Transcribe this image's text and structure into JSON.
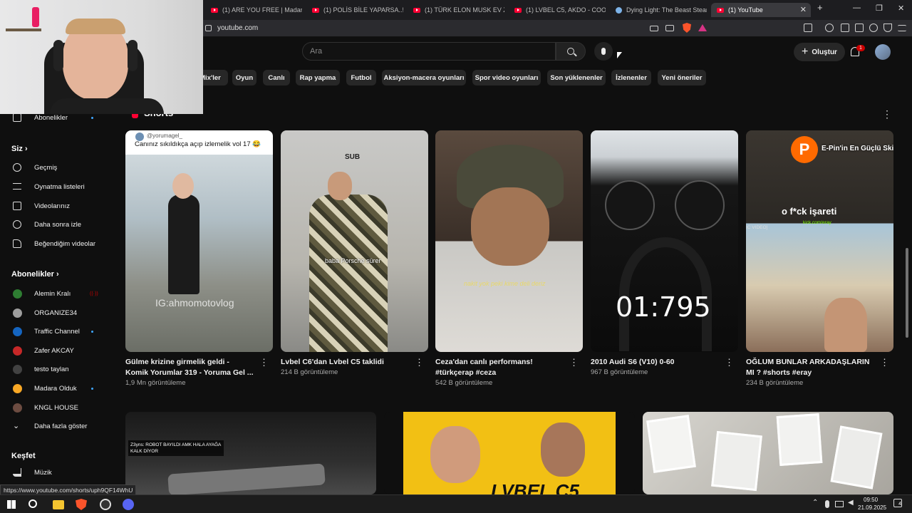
{
  "browser": {
    "tabs": [
      {
        "label": "(1) ARE YOU FREE | Madara Ol"
      },
      {
        "label": "(1) POLİS BİLE YAPARSA..! Türki"
      },
      {
        "label": "(1) TÜRK ELON MUSK EV ZİYAR"
      },
      {
        "label": "(1) LVBEL C5, AKDO - COOOK İ"
      },
      {
        "label": "Dying Light: The Beast Steam'd"
      },
      {
        "label": "(1) YouTube"
      }
    ],
    "url": "youtube.com",
    "window_controls": {
      "minimize": "—",
      "restore": "❐",
      "close": "✕"
    },
    "new_tab": "+"
  },
  "youtube": {
    "search_placeholder": "Ara",
    "create_label": "Oluştur",
    "notification_count": "1",
    "chips": [
      "Mix'ler",
      "Oyun",
      "Canlı",
      "Rap yapma",
      "Futbol",
      "Aksiyon-macera oyunları",
      "Spor video oyunları",
      "Son yüklenenler",
      "İzlenenler",
      "Yeni öneriler"
    ],
    "sidebar": {
      "top_item": "Abonelikler",
      "you_header": "Siz",
      "you_items": [
        "Geçmiş",
        "Oynatma listeleri",
        "Videolarınız",
        "Daha sonra izle",
        "Beğendiğim videolar"
      ],
      "subs_header": "Abonelikler",
      "subs": [
        {
          "name": "Alemin Kralı",
          "live": "((·))",
          "color": "#2e7d32"
        },
        {
          "name": "ORGANIZE34",
          "color": "#9e9e9e"
        },
        {
          "name": "Traffic Channel",
          "color": "#1565c0"
        },
        {
          "name": "Zafer AKCAY",
          "color": "#c62828"
        },
        {
          "name": "testo taylan",
          "color": "#424242"
        },
        {
          "name": "Madara Olduk",
          "color": "#f9a825"
        },
        {
          "name": "KNGL HOUSE",
          "color": "#6d4c41"
        }
      ],
      "show_more": "Daha fazla göster",
      "explore_header": "Keşfet",
      "explore_items": [
        "Müzik"
      ]
    },
    "shorts": {
      "section_title": "Shorts",
      "items": [
        {
          "title": "Gülme krizine girmelik geldi - Komik Yorumlar 319 - Yoruma Gel ...",
          "views": "1,9 Mn görüntüleme",
          "handle": "@yorumagel_",
          "caption": "Canınız sıkıldıkça açıp izlemelik vol 17 😂",
          "watermark": "IG:ahmomotovlog"
        },
        {
          "title": "Lvbel C6'dan Lvbel C5 taklidi",
          "views": "214 B görüntüleme",
          "brand": "SUB",
          "caption": "baba Porsche sürer"
        },
        {
          "title": "Ceza'dan canlı performans! #türkçerap #ceza",
          "views": "542 B görüntüleme",
          "caption": "nakit yok peki kime deli deriz"
        },
        {
          "title": "2010 Audi S6 (V10) 0-60",
          "views": "967 B görüntüleme",
          "timer": "01:795"
        },
        {
          "title": "OĞLUM BUNLAR ARKADAŞLARIN MI ? #shorts #eray",
          "views": "234 B görüntüleme",
          "top_banner": "E-Pin'in En Güçlü Skilli",
          "caption": "o f*ck işareti",
          "sub_caption": "kick.com/eray",
          "tag": "IC VIDEO]"
        }
      ]
    },
    "bottom_thumbs": [
      {
        "caption": "Z3yns: ROBOT BAYILDI AMK HALA AYAĞA KALK DİYOR"
      },
      {
        "caption": "LVBEL C5"
      },
      {
        "caption": ""
      }
    ],
    "status_url": "https://www.youtube.com/shorts/uph9QF14WhU"
  },
  "taskbar": {
    "time": "09:50",
    "date": "21.09.2025",
    "notif_count": "4"
  }
}
